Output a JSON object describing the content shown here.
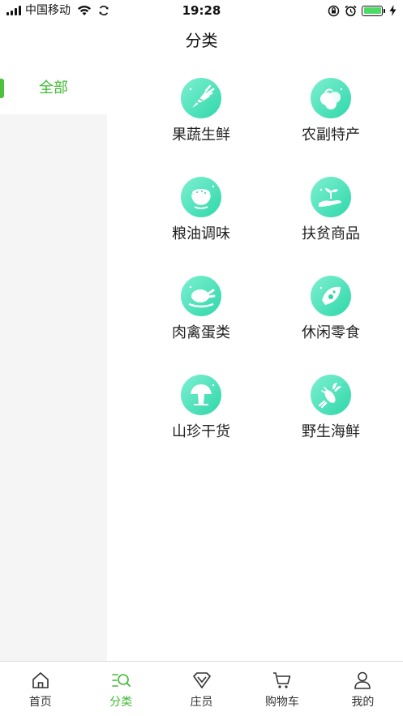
{
  "status_bar": {
    "carrier": "中国移动",
    "time": "19:28"
  },
  "header": {
    "title": "分类"
  },
  "sidebar": {
    "items": [
      {
        "label": "全部",
        "active": true
      }
    ]
  },
  "categories": [
    {
      "label": "果蔬生鲜",
      "icon": "carrot-icon"
    },
    {
      "label": "农副特产",
      "icon": "produce-basket-icon"
    },
    {
      "label": "粮油调味",
      "icon": "rice-bowl-icon"
    },
    {
      "label": "扶贫商品",
      "icon": "hand-sprout-icon"
    },
    {
      "label": "肉禽蛋类",
      "icon": "roast-chicken-icon"
    },
    {
      "label": "休闲零食",
      "icon": "snack-bag-icon"
    },
    {
      "label": "山珍干货",
      "icon": "mushroom-icon"
    },
    {
      "label": "野生海鲜",
      "icon": "lobster-icon"
    }
  ],
  "tab_bar": {
    "tabs": [
      {
        "label": "首页",
        "icon": "home-icon",
        "active": false
      },
      {
        "label": "分类",
        "icon": "category-search-icon",
        "active": true
      },
      {
        "label": "庄员",
        "icon": "diamond-icon",
        "active": false
      },
      {
        "label": "购物车",
        "icon": "cart-icon",
        "active": false
      },
      {
        "label": "我的",
        "icon": "user-icon",
        "active": false
      }
    ]
  },
  "colors": {
    "accent": "#3fb932",
    "icon_gradient_start": "#7ef0d2",
    "icon_gradient_end": "#2fd7a9",
    "sidebar_background": "#f5f5f5"
  }
}
